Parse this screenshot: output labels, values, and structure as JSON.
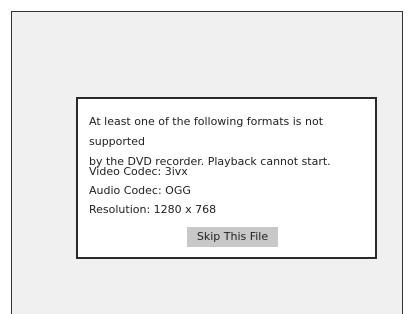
{
  "dialog": {
    "message_line1": "At least one of the following formats is not supported",
    "message_line2": "by the DVD recorder. Playback cannot start.",
    "video_codec": "Video Codec: 3ivx",
    "audio_codec": "Audio Codec: OGG",
    "resolution": "Resolution: 1280 x 768",
    "skip_button_label": "Skip This File"
  },
  "colors": {
    "screen_bg": "#f0f0f0",
    "dialog_bg": "#ffffff",
    "dialog_border": "#2a2a2a",
    "button_bg": "#c8c8c8"
  }
}
